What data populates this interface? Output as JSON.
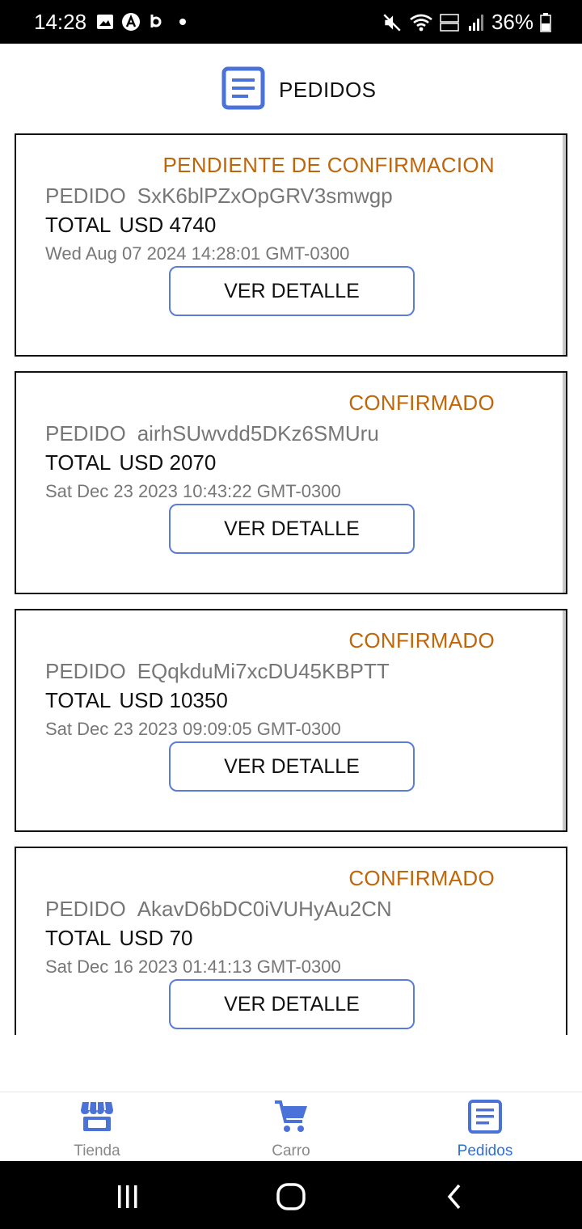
{
  "status_bar": {
    "time": "14:28",
    "battery": "36%"
  },
  "header": {
    "title": "PEDIDOS",
    "icon": "document-list-icon"
  },
  "orders": [
    {
      "status": "PENDIENTE DE CONFIRMACION",
      "id_label": "PEDIDO",
      "id": "SxK6blPZxOpGRV3smwgp",
      "total_label": "TOTAL",
      "total": "USD 4740",
      "date": "Wed Aug 07 2024 14:28:01 GMT-0300",
      "button": "VER DETALLE"
    },
    {
      "status": "CONFIRMADO",
      "id_label": "PEDIDO",
      "id": "airhSUwvdd5DKz6SMUru",
      "total_label": "TOTAL",
      "total": "USD 2070",
      "date": "Sat Dec 23 2023 10:43:22 GMT-0300",
      "button": "VER DETALLE"
    },
    {
      "status": "CONFIRMADO",
      "id_label": "PEDIDO",
      "id": "EQqkduMi7xcDU45KBPTT",
      "total_label": "TOTAL",
      "total": "USD 10350",
      "date": "Sat Dec 23 2023 09:09:05 GMT-0300",
      "button": "VER DETALLE"
    },
    {
      "status": "CONFIRMADO",
      "id_label": "PEDIDO",
      "id": "AkavD6bDC0iVUHyAu2CN",
      "total_label": "TOTAL",
      "total": "USD 70",
      "date": "Sat Dec 16 2023 01:41:13 GMT-0300",
      "button": "VER DETALLE"
    }
  ],
  "bottom_nav": [
    {
      "label": "Tienda",
      "icon": "storefront-icon",
      "active": false
    },
    {
      "label": "Carro",
      "icon": "cart-icon",
      "active": false
    },
    {
      "label": "Pedidos",
      "icon": "document-list-icon",
      "active": true
    }
  ],
  "colors": {
    "accent": "#2E6FD8",
    "icon_blue": "#4A72D9",
    "status_orange": "#C0660A",
    "button_border": "#5A7BD8"
  }
}
